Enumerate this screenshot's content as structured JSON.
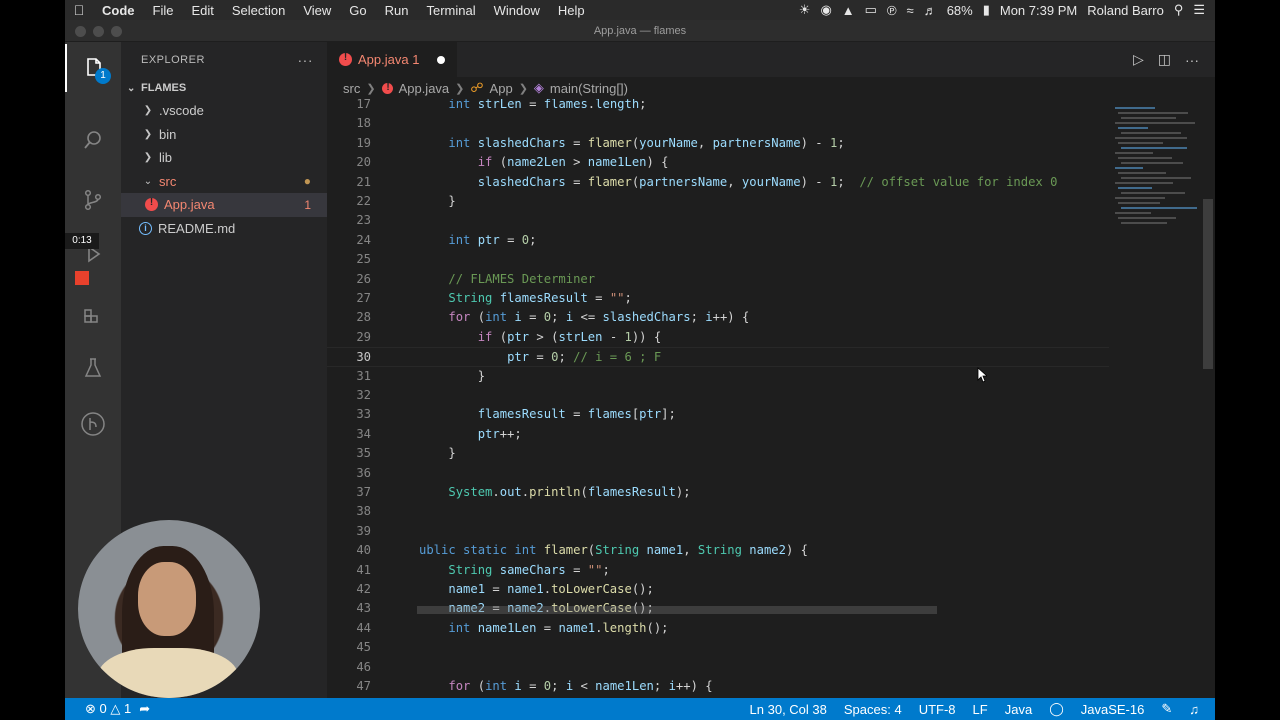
{
  "menubar": {
    "app_name": "Code",
    "items": [
      "File",
      "Edit",
      "Selection",
      "View",
      "Go",
      "Run",
      "Terminal",
      "Window",
      "Help"
    ],
    "battery": "68%",
    "clock": "Mon 7:39 PM",
    "user": "Roland Barro"
  },
  "window": {
    "title": "App.java — flames"
  },
  "recording": {
    "timer": "0:13"
  },
  "activity": {
    "explorer_badge": "1"
  },
  "sidebar": {
    "title": "EXPLORER",
    "folder": "FLAMES",
    "items": [
      {
        "label": ".vscode"
      },
      {
        "label": "bin"
      },
      {
        "label": "lib"
      },
      {
        "label": "src"
      },
      {
        "label": "App.java",
        "count": "1"
      },
      {
        "label": "README.md"
      }
    ]
  },
  "tabs": [
    {
      "label": "App.java 1"
    }
  ],
  "breadcrumbs": [
    "src",
    "App.java",
    "App",
    "main(String[])"
  ],
  "editor": {
    "lines": [
      {
        "n": "17",
        "code": "    int strLen = flames.length;"
      },
      {
        "n": "18",
        "code": ""
      },
      {
        "n": "19",
        "code": "    int slashedChars = flamer(yourName, partnersName) - 1;"
      },
      {
        "n": "20",
        "code": "        if (name2Len > name1Len) {"
      },
      {
        "n": "21",
        "code": "        slashedChars = flamer(partnersName, yourName) - 1;  // offset value for index 0"
      },
      {
        "n": "22",
        "code": "    }"
      },
      {
        "n": "23",
        "code": ""
      },
      {
        "n": "24",
        "code": "    int ptr = 0;"
      },
      {
        "n": "25",
        "code": ""
      },
      {
        "n": "26",
        "code": "    // FLAMES Determiner"
      },
      {
        "n": "27",
        "code": "    String flamesResult = \"\";"
      },
      {
        "n": "28",
        "code": "    for (int i = 0; i <= slashedChars; i++) {"
      },
      {
        "n": "29",
        "code": "        if (ptr > (strLen - 1)) {"
      },
      {
        "n": "30",
        "code": "            ptr = 0; // i = 6 ; F"
      },
      {
        "n": "31",
        "code": "        }"
      },
      {
        "n": "32",
        "code": ""
      },
      {
        "n": "33",
        "code": "        flamesResult = flames[ptr];"
      },
      {
        "n": "34",
        "code": "        ptr++;"
      },
      {
        "n": "35",
        "code": "    }"
      },
      {
        "n": "36",
        "code": ""
      },
      {
        "n": "37",
        "code": "    System.out.println(flamesResult);"
      },
      {
        "n": "38",
        "code": ""
      },
      {
        "n": "39",
        "code": ""
      },
      {
        "n": "40",
        "code": "ublic static int flamer(String name1, String name2) {"
      },
      {
        "n": "41",
        "code": "    String sameChars = \"\";"
      },
      {
        "n": "42",
        "code": "    name1 = name1.toLowerCase();"
      },
      {
        "n": "43",
        "code": "    name2 = name2.toLowerCase();"
      },
      {
        "n": "44",
        "code": "    int name1Len = name1.length();"
      },
      {
        "n": "45",
        "code": ""
      },
      {
        "n": "46",
        "code": ""
      },
      {
        "n": "47",
        "code": "    for (int i = 0; i < name1Len; i++) {"
      }
    ]
  },
  "statusbar": {
    "errors": "0",
    "warnings": "1",
    "position": "Ln 30, Col 38",
    "spaces": "Spaces: 4",
    "encoding": "UTF-8",
    "eol": "LF",
    "language": "Java",
    "runtime": "JavaSE-16"
  }
}
